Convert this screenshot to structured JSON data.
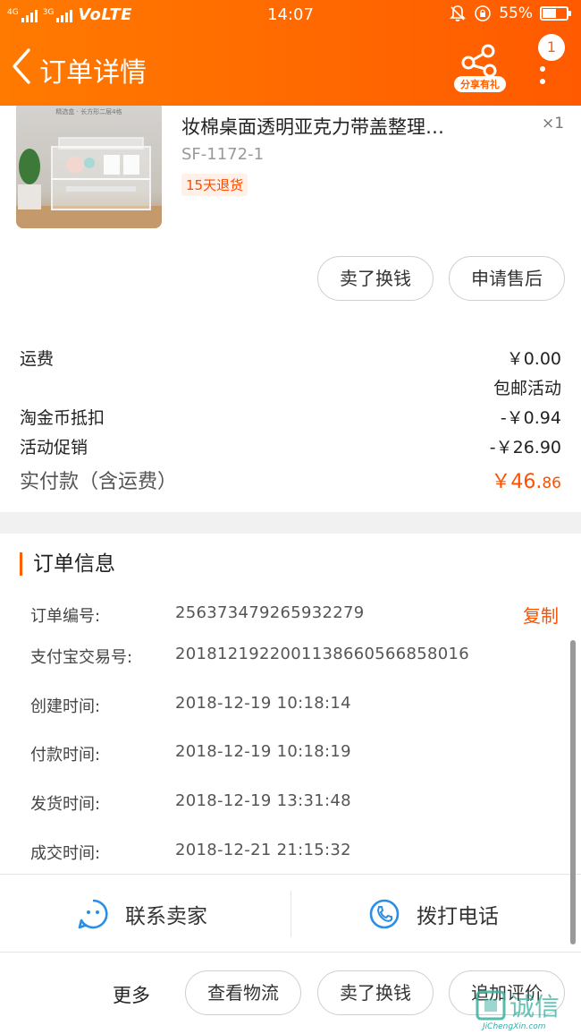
{
  "status_bar": {
    "sim1_label": "4G",
    "sim2_label": "3G",
    "network": "VoLTE",
    "time": "14:07",
    "battery": "55%"
  },
  "nav": {
    "title": "订单详情",
    "share_label": "分享有礼",
    "message_count": "1"
  },
  "product": {
    "image_caption": "精选盒 · 长方形二层4格",
    "title": "妆棉桌面透明亚克力带盖整理…",
    "quantity": "×1",
    "sku": "SF-1172-1",
    "return_policy": "15天退货",
    "buttons": {
      "sell": "卖了换钱",
      "after_sale": "申请售后"
    }
  },
  "price": {
    "shipping_label": "运费",
    "shipping_value": "￥0.00",
    "shipping_note": "包邮活动",
    "coin_label": "淘金币抵扣",
    "coin_value": "-￥0.94",
    "promo_label": "活动促销",
    "promo_value": "-￥26.90",
    "total_label": "实付款（含运费）",
    "total_main": "￥46.",
    "total_cents": "86"
  },
  "order_info": {
    "heading": "订单信息",
    "copy_label": "复制",
    "rows": [
      {
        "label": "订单编号:",
        "value": "256373479265932279"
      },
      {
        "label": "支付宝交易号:",
        "value": "2018121922001138660566858016"
      },
      {
        "label": "创建时间:",
        "value": "2018-12-19 10:18:14"
      },
      {
        "label": "付款时间:",
        "value": "2018-12-19 10:18:19"
      },
      {
        "label": "发货时间:",
        "value": "2018-12-19 13:31:48"
      },
      {
        "label": "成交时间:",
        "value": "2018-12-21 21:15:32"
      }
    ]
  },
  "contact": {
    "seller": "联系卖家",
    "phone": "拨打电话"
  },
  "bottom_bar": {
    "more": "更多",
    "logistics": "查看物流",
    "sell": "卖了换钱",
    "review": "追加评价"
  },
  "watermark": {
    "logo": "诚信",
    "site": "JiChengXin.com"
  },
  "colors": {
    "accent": "#ff6000",
    "price": "#ff5000",
    "header_start": "#ff7a00",
    "header_end": "#ff5a00"
  }
}
